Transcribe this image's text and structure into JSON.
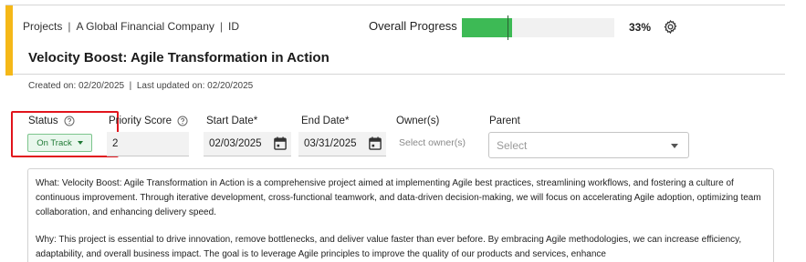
{
  "breadcrumb": {
    "projects": "Projects",
    "company": "A Global Financial Company",
    "id": "ID",
    "separator": "|"
  },
  "progress": {
    "label": "Overall Progress",
    "percent_text": "33%",
    "fill_fraction": 0.33,
    "marker_fraction": 0.3,
    "fill_color": "#3dba55"
  },
  "title": "Velocity Boost: Agile Transformation in Action",
  "meta": {
    "created_label": "Created on:",
    "created_date": "02/20/2025",
    "sep": "|",
    "updated_label": "Last updated on:",
    "updated_date": "02/20/2025"
  },
  "fields": {
    "status": {
      "label": "Status",
      "value": "On Track",
      "color": "#1f7a35"
    },
    "priority": {
      "label": "Priority Score",
      "value": "2"
    },
    "start": {
      "label": "Start Date*",
      "value": "02/03/2025"
    },
    "end": {
      "label": "End Date*",
      "value": "03/31/2025"
    },
    "owner": {
      "label": "Owner(s)",
      "placeholder": "Select owner(s)"
    },
    "parent": {
      "label": "Parent",
      "placeholder": "Select"
    }
  },
  "description": {
    "what": "What: Velocity Boost: Agile Transformation in Action is a comprehensive project aimed at implementing Agile best practices, streamlining workflows, and fostering a culture of continuous improvement. Through iterative development, cross-functional teamwork, and data-driven decision-making, we will focus on accelerating Agile adoption, optimizing team collaboration, and enhancing delivery speed.",
    "why": "Why: This project is essential to drive innovation, remove bottlenecks, and deliver value faster than ever before. By embracing Agile methodologies, we can increase efficiency, adaptability, and overall business impact. The goal is to leverage Agile principles to improve the quality of our products and services, enhance"
  },
  "icons": {
    "settings": "gear-icon",
    "help": "help-circle-icon",
    "calendar": "calendar-icon",
    "dropdown": "chevron-down-icon"
  },
  "colors": {
    "accent": "#f5b818",
    "highlight": "#e1141c"
  }
}
